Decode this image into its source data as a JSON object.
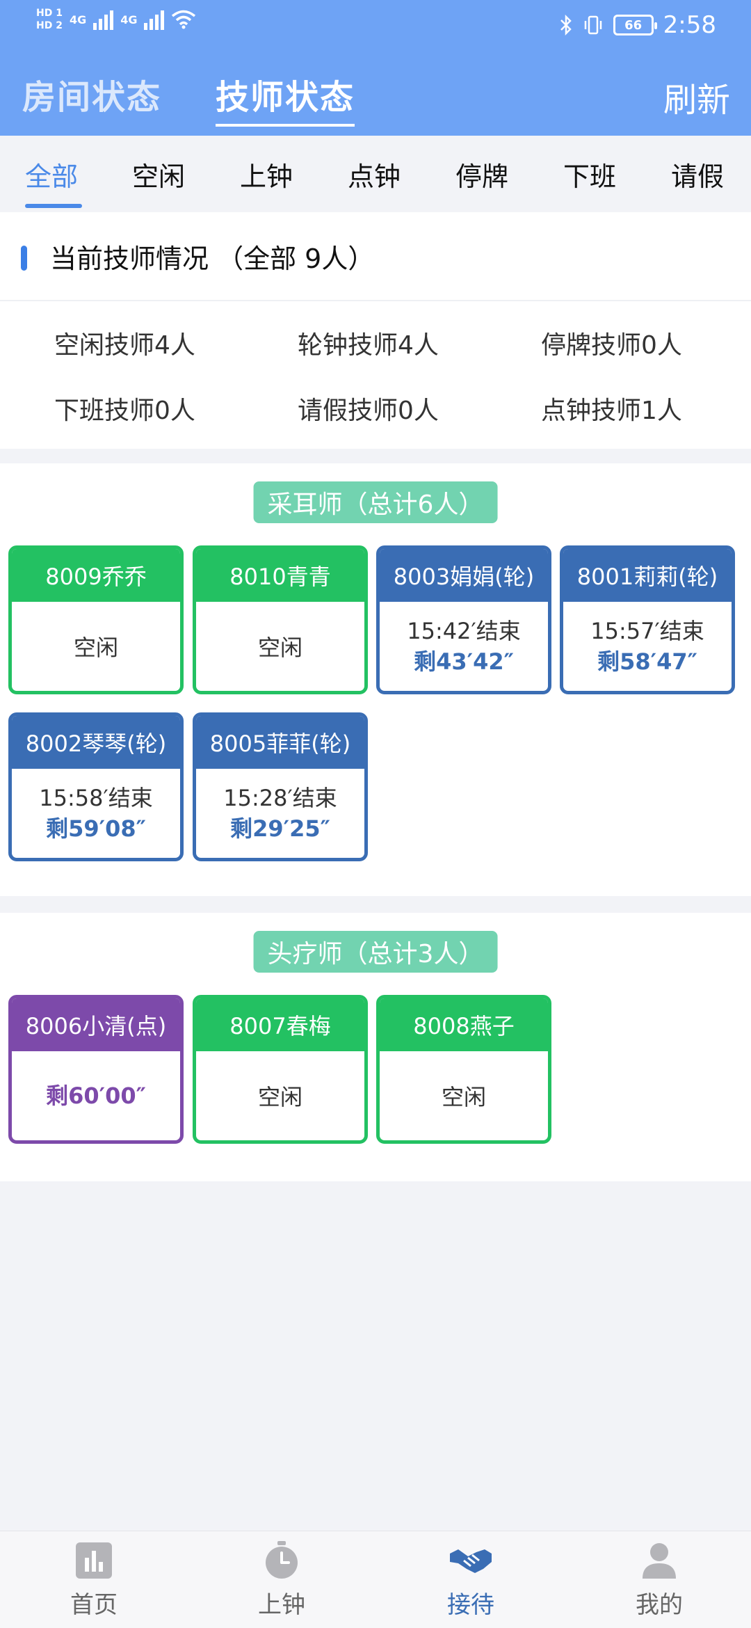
{
  "status_bar": {
    "hd1": "HD 1",
    "hd2": "HD 2",
    "net1": "4G",
    "net2": "4G",
    "battery": "66",
    "time": "2:58"
  },
  "header": {
    "tab_room": "房间状态",
    "tab_tech": "技师状态",
    "refresh": "刷新"
  },
  "filters": [
    "全部",
    "空闲",
    "上钟",
    "点钟",
    "停牌",
    "下班",
    "请假"
  ],
  "overview": {
    "title": "当前技师情况 （全部 9人）",
    "stats": [
      "空闲技师4人",
      "轮钟技师4人",
      "停牌技师0人",
      "下班技师0人",
      "请假技师0人",
      "点钟技师1人"
    ]
  },
  "groups": [
    {
      "title": "采耳师（总计6人）",
      "cards": [
        {
          "name": "8009乔乔",
          "status": "空闲",
          "color": "#23c162"
        },
        {
          "name": "8010青青",
          "status": "空闲",
          "color": "#23c162"
        },
        {
          "name": "8003娟娟(轮)",
          "end": "15:42′结束",
          "remain": "剩43′42″",
          "color": "#3a6db4"
        },
        {
          "name": "8001莉莉(轮)",
          "end": "15:57′结束",
          "remain": "剩58′47″",
          "color": "#3a6db4"
        },
        {
          "name": "8002琴琴(轮)",
          "end": "15:58′结束",
          "remain": "剩59′08″",
          "color": "#3a6db4"
        },
        {
          "name": "8005菲菲(轮)",
          "end": "15:28′结束",
          "remain": "剩29′25″",
          "color": "#3a6db4"
        }
      ]
    },
    {
      "title": "头疗师（总计3人）",
      "cards": [
        {
          "name": "8006小清(点)",
          "remain": "剩60′00″",
          "color": "#7d4aaa"
        },
        {
          "name": "8007春梅",
          "status": "空闲",
          "color": "#23c162"
        },
        {
          "name": "8008燕子",
          "status": "空闲",
          "color": "#23c162"
        }
      ]
    }
  ],
  "nav": {
    "home": "首页",
    "clock": "上钟",
    "reception": "接待",
    "mine": "我的"
  },
  "colors": {
    "header_bg": "#6ea3f5",
    "accent_blue": "#4a89e8",
    "idle_green": "#23c162",
    "rotation_blue": "#3a6db4",
    "appointed_purple": "#7d4aaa",
    "group_badge": "#72d3b0"
  }
}
